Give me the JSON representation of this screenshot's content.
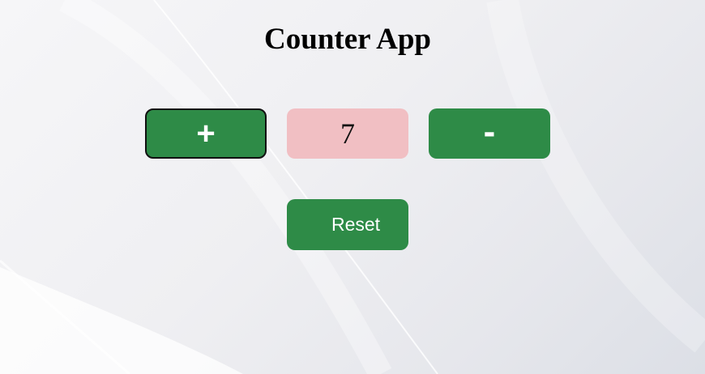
{
  "app": {
    "title": "Counter App"
  },
  "counter": {
    "increment_label": "+",
    "value": "7",
    "decrement_label": "-",
    "reset_label": "Reset"
  },
  "colors": {
    "button_green": "#2e8b47",
    "count_bg_pink": "#f1bfc3",
    "page_bg": "#efeff2"
  }
}
